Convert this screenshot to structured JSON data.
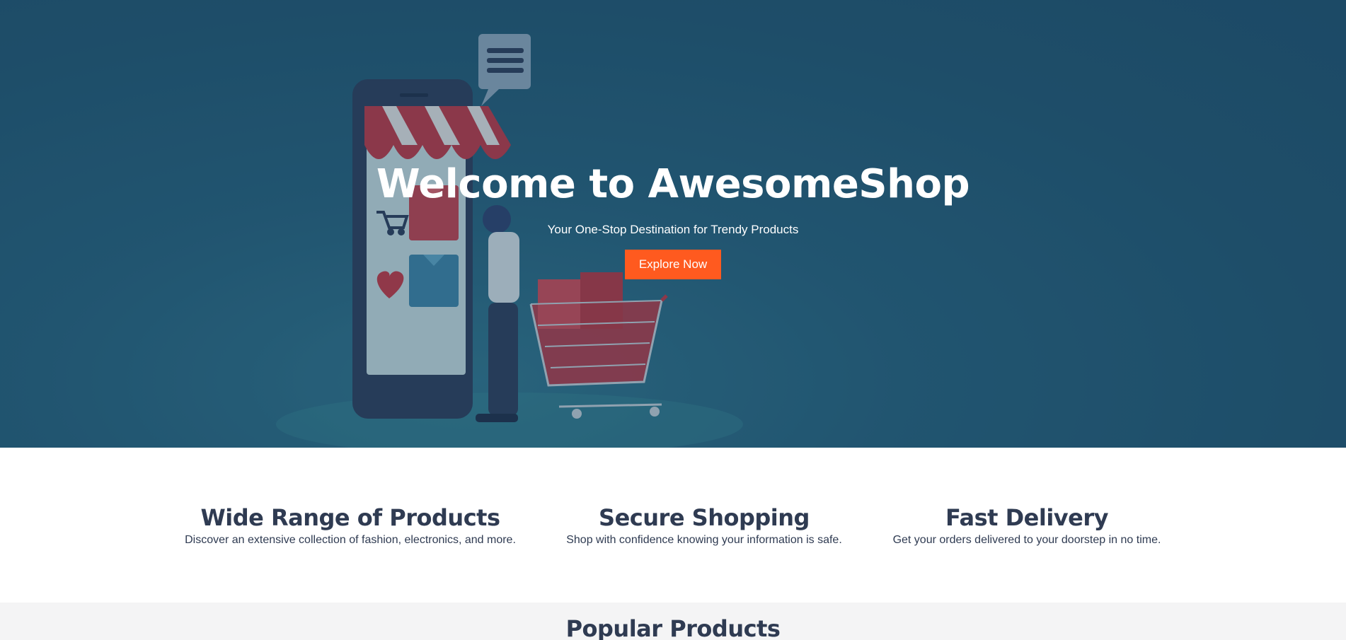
{
  "hero": {
    "title": "Welcome to AwesomeShop",
    "subtitle": "Your One-Stop Destination for Trendy Products",
    "cta_label": "Explore Now",
    "illustration": {
      "icons": [
        "phone-storefront-icon",
        "chat-bubble-icon",
        "shopping-cart-icon",
        "heart-icon",
        "shirt-icon",
        "person-icon",
        "trolley-icon"
      ]
    }
  },
  "features": [
    {
      "title": "Wide Range of Products",
      "description": "Discover an extensive collection of fashion, electronics, and more."
    },
    {
      "title": "Secure Shopping",
      "description": "Shop with confidence knowing your information is safe."
    },
    {
      "title": "Fast Delivery",
      "description": "Get your orders delivered to your doorstep in no time."
    }
  ],
  "popular": {
    "title": "Popular Products"
  },
  "colors": {
    "hero_bg": "#1f4f6a",
    "accent": "#ff5a1f",
    "heading": "#2f3b52",
    "section_bg": "#f4f4f5"
  }
}
